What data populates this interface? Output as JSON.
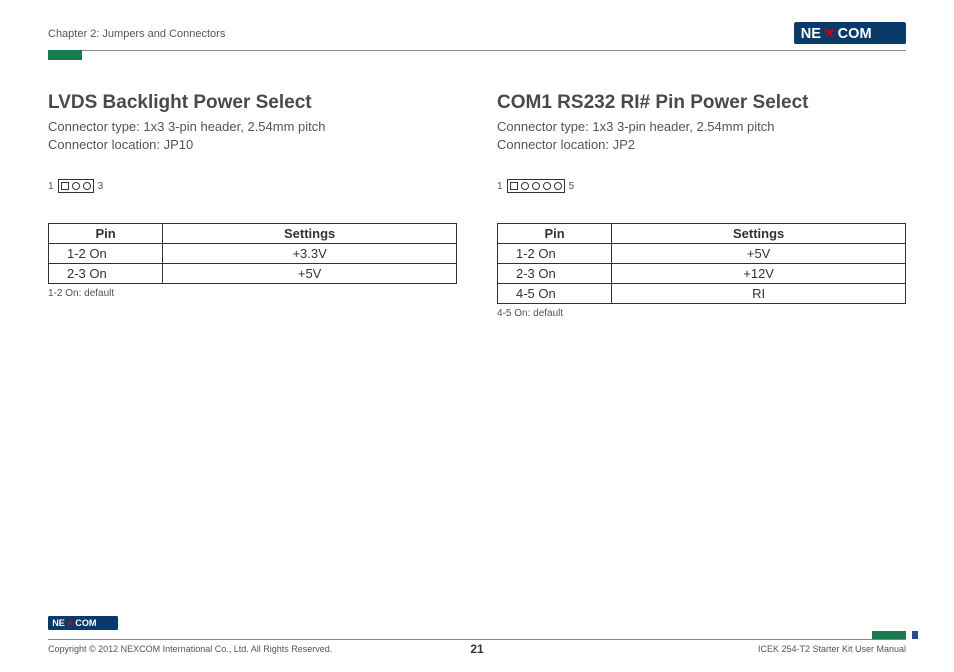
{
  "header": {
    "chapter": "Chapter 2: Jumpers and Connectors",
    "logo_text": "NEXCOM"
  },
  "left": {
    "title": "LVDS Backlight Power Select",
    "conn_type": "Connector type: 1x3 3-pin header, 2.54mm pitch",
    "conn_loc": "Connector location: JP10",
    "pin_start": "1",
    "pin_end": "3",
    "th_pin": "Pin",
    "th_set": "Settings",
    "rows": [
      {
        "pin": "1-2 On",
        "set": "+3.3V"
      },
      {
        "pin": "2-3 On",
        "set": "+5V"
      }
    ],
    "default": "1-2 On: default"
  },
  "right": {
    "title": "COM1 RS232 RI# Pin Power Select",
    "conn_type": "Connector type: 1x3 3-pin header, 2.54mm pitch",
    "conn_loc": "Connector location: JP2",
    "pin_start": "1",
    "pin_end": "5",
    "th_pin": "Pin",
    "th_set": "Settings",
    "rows": [
      {
        "pin": "1-2 On",
        "set": "+5V"
      },
      {
        "pin": "2-3 On",
        "set": "+12V"
      },
      {
        "pin": "4-5 On",
        "set": "RI"
      }
    ],
    "default": "4-5 On: default"
  },
  "footer": {
    "copyright": "Copyright © 2012 NEXCOM International Co., Ltd. All Rights Reserved.",
    "page": "21",
    "manual": "ICEK 254-T2 Starter Kit User Manual"
  }
}
